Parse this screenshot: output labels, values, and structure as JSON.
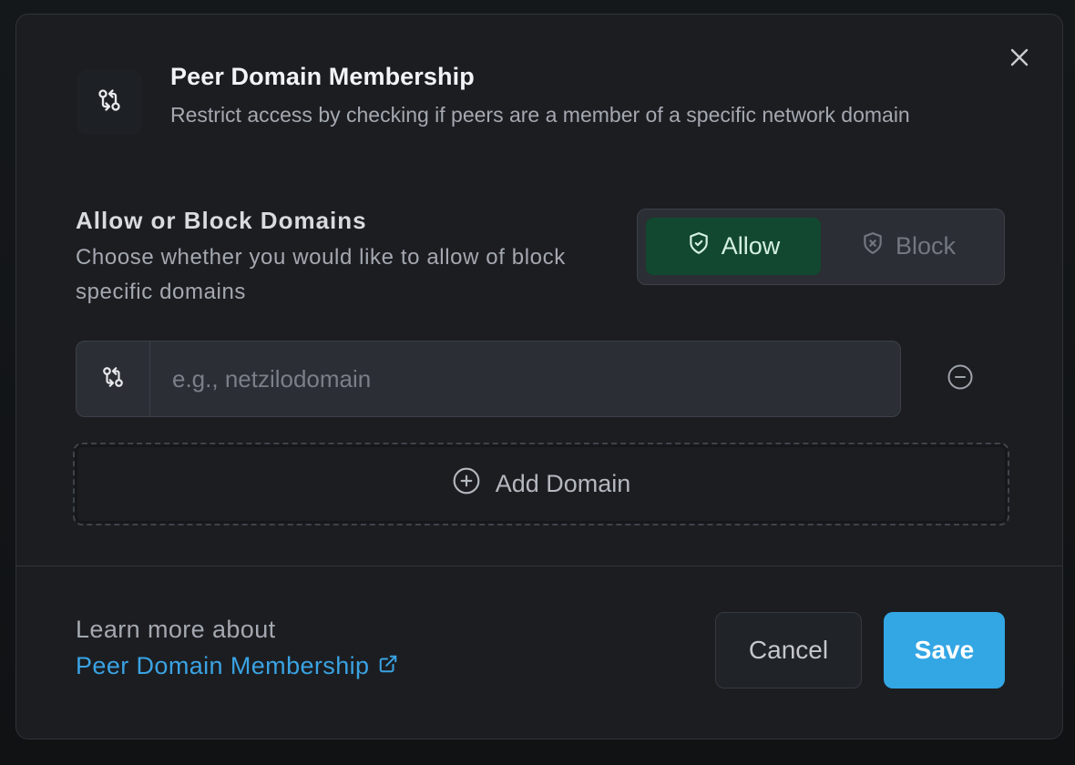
{
  "dialog": {
    "title": "Peer Domain Membership",
    "subtitle": "Restrict access by checking if peers are a member of a specific network domain",
    "header_icon": "git-compare-icon",
    "close_icon": "close-icon"
  },
  "section": {
    "title": "Allow or Block Domains",
    "description": "Choose whether you would like to allow of block specific domains"
  },
  "toggle": {
    "selected": "allow",
    "allow_label": "Allow",
    "allow_icon": "shield-check-icon",
    "block_label": "Block",
    "block_icon": "shield-x-icon"
  },
  "domain_input": {
    "value": "",
    "placeholder": "e.g., netzilodomain",
    "icon": "git-compare-icon",
    "remove_icon": "minus-circle-icon"
  },
  "add_domain": {
    "label": "Add Domain",
    "icon": "plus-circle-icon"
  },
  "footer": {
    "learn_more_text": "Learn more about",
    "learn_more_link": "Peer Domain Membership",
    "link_icon": "external-link-icon",
    "cancel_label": "Cancel",
    "save_label": "Save"
  },
  "colors": {
    "modal_bg": "#1b1d21",
    "allow_active_bg": "#12482f",
    "accent_blue": "#33a6e4",
    "link_blue": "#3aa3e3"
  }
}
